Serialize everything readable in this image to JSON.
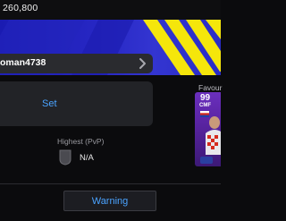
{
  "header": {
    "coins": "260,800"
  },
  "profile": {
    "username": "oman4738",
    "set_label": "Set",
    "highest_label": "Highest (PvP)",
    "highest_value": "N/A"
  },
  "favourite": {
    "label": "Favour",
    "rating": "99",
    "position": "CMF"
  },
  "footer": {
    "warning_label": "Warning"
  },
  "colors": {
    "banner_blue": "#2a2bc2",
    "banner_stripe": "#f5e60b",
    "link_blue": "#4aa3ff",
    "card_purple": "#5a24a3"
  }
}
